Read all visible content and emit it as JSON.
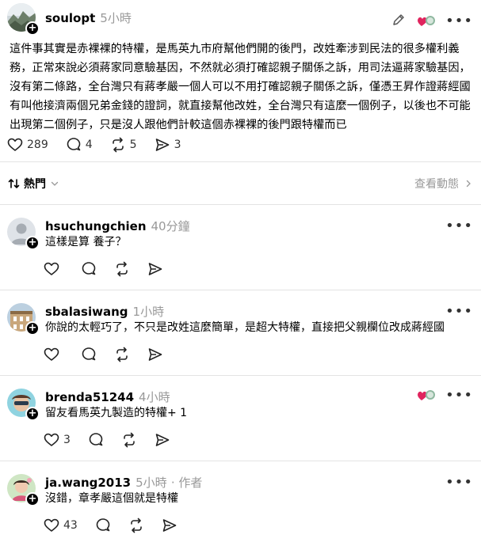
{
  "main_post": {
    "username": "soulopt",
    "time": "5小時",
    "text": "這件事其實是赤裸裸的特權，是馬英九市府幫他們開的後門，改姓牽涉到民法的很多權利義務，正常來說必須蔣家同意驗基因，不然就必須打確認親子關係之訴，用司法逼蔣家驗基因，沒有第二條路，全台灣只有蔣孝嚴一個人可以不用打確認親子關係之訴，僅憑王昇作證蔣經國有叫他接濟兩個兄弟金錢的證詞，就直接幫他改姓，全台灣只有這麼一個例子，以後也不可能出現第二個例子，只是沒人跟他們計較這個赤裸裸的後門跟特權而已",
    "likes": "289",
    "comments": "4",
    "reposts": "5",
    "shares": "3"
  },
  "sort": {
    "label": "熱門",
    "view_activity": "查看動態"
  },
  "replies": [
    {
      "username": "hsuchungchien",
      "time": "40分鐘",
      "author_tag": "",
      "text": "這樣是算 養子？",
      "likes": ""
    },
    {
      "username": "sbalasiwang",
      "time": "1小時",
      "author_tag": "",
      "text": "你說的太輕巧了，不只是改姓這麼簡單，是超大特權，直接把父親欄位改成蔣經國",
      "likes": ""
    },
    {
      "username": "brenda51244",
      "time": "4小時",
      "author_tag": "",
      "text": "留友看馬英九製造的特權+ 1",
      "likes": "3"
    },
    {
      "username": "ja.wang2013",
      "time": "5小時",
      "author_tag": "· 作者",
      "text": "沒錯，章孝嚴這個就是特權",
      "likes": "43"
    }
  ],
  "colors": {
    "muted": "#999999",
    "divider": "#e3e3e3",
    "heart_red": "#e0245e"
  }
}
